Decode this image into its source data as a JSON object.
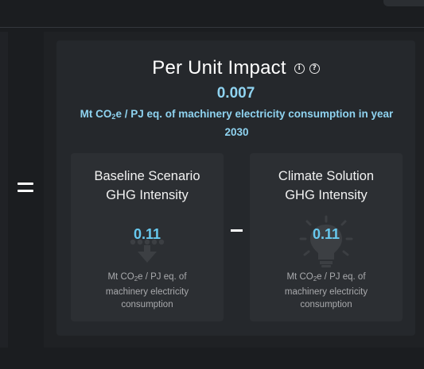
{
  "header": {
    "title": "Per Unit Impact",
    "info_icon": "info-icon",
    "help_icon": "question-icon"
  },
  "impact": {
    "value": "0.007",
    "unit_prefix": "Mt CO",
    "unit_subscript": "2",
    "unit_suffix": "e / PJ eq. of machinery electricity consumption in year 2030"
  },
  "operators": {
    "equals_icon": "equals-icon",
    "minus_icon": "minus-icon"
  },
  "baseline": {
    "title_line1": "Baseline Scenario",
    "title_line2": "GHG Intensity",
    "value": "0.11",
    "icon": "downward-emission-icon",
    "unit_prefix": "Mt CO",
    "unit_subscript": "2",
    "unit_suffix": "e / PJ eq. of",
    "unit_line2": "machinery electricity",
    "unit_line3": "consumption"
  },
  "solution": {
    "title_line1": "Climate Solution",
    "title_line2": "GHG Intensity",
    "value": "0.11",
    "icon": "lightbulb-icon",
    "unit_prefix": "Mt CO",
    "unit_subscript": "2",
    "unit_suffix": "e / PJ eq. of",
    "unit_line2": "machinery electricity",
    "unit_line3": "consumption"
  },
  "colors": {
    "background": "#1b1d20",
    "card": "#25282c",
    "box": "#2c2f33",
    "accent_light": "#8fd3f0",
    "accent": "#67c8ee"
  }
}
